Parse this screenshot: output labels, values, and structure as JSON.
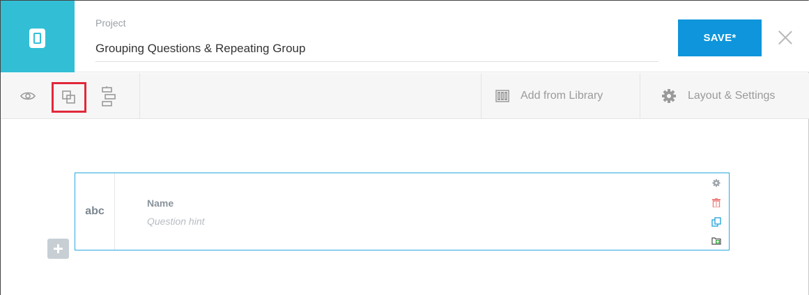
{
  "header": {
    "project_label": "Project",
    "project_name": "Grouping Questions & Repeating Group",
    "save_label": "SAVE*"
  },
  "toolbar": {
    "add_from_library_label": "Add from Library",
    "layout_settings_label": "Layout & Settings",
    "tools": [
      "eye-icon",
      "clone-icon",
      "logic-tree-icon"
    ]
  },
  "question": {
    "type_label": "abc",
    "label": "Name",
    "hint": "Question hint"
  },
  "colors": {
    "brand": "#32bfd6",
    "save": "#0e95db",
    "selection": "#e2283a",
    "card_border": "#2aa7dd"
  }
}
